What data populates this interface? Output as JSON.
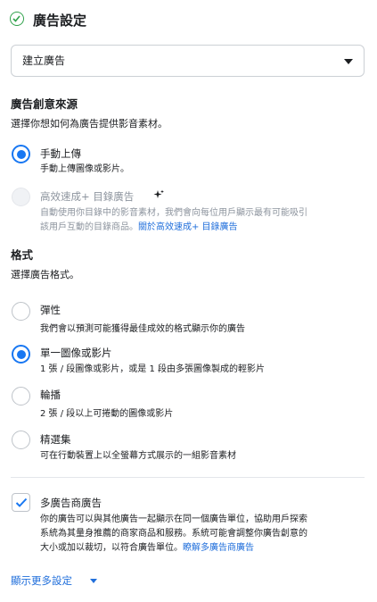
{
  "header": {
    "title": "廣告設定"
  },
  "objective_select": {
    "value": "建立廣告"
  },
  "creative_source": {
    "heading": "廣告創意來源",
    "subtitle": "選擇你想如何為廣告提供影音素材。",
    "options": [
      {
        "label": "手動上傳",
        "description": "手動上傳圖像或影片。",
        "selected": true,
        "disabled": false
      },
      {
        "label": "高效速成+ 目錄廣告",
        "description_line1": "自動使用你目錄中的影音素材，我們會向每位用戶顯示最有可能吸引",
        "description_line2_prefix": "該用戶互動的目錄商品。",
        "link": "關於高效速成+ 目錄廣告",
        "selected": false,
        "disabled": true
      }
    ]
  },
  "format": {
    "heading": "格式",
    "subtitle": "選擇廣告格式。",
    "options": [
      {
        "label": "彈性",
        "description": "我們會以預測可能獲得最佳成效的格式顯示你的廣告",
        "selected": false
      },
      {
        "label": "單一圖像或影片",
        "description": "1 張 / 段圖像或影片，或是 1 段由多張圖像製成的輕影片",
        "selected": true
      },
      {
        "label": "輪播",
        "description": "2 張 / 段以上可捲動的圖像或影片",
        "selected": false
      },
      {
        "label": "精選集",
        "description": "可在行動裝置上以全螢幕方式展示的一組影音素材",
        "selected": false
      }
    ]
  },
  "multi_advertiser": {
    "label": "多廣告商廣告",
    "checked": true,
    "description_line1": "你的廣告可以與其他廣告一起顯示在同一個廣告單位，協助用戶探索",
    "description_line2": "系統為其量身推薦的商家商品和服務。系統可能會調整你廣告創意的",
    "description_line3_prefix": "大小或加以裁切，以符合廣告單位。",
    "link": "瞭解多廣告商廣告"
  },
  "show_more": {
    "label": "顯示更多設定"
  },
  "colors": {
    "accent": "#1877f2",
    "link": "#216fdb",
    "success": "#31a24c"
  }
}
